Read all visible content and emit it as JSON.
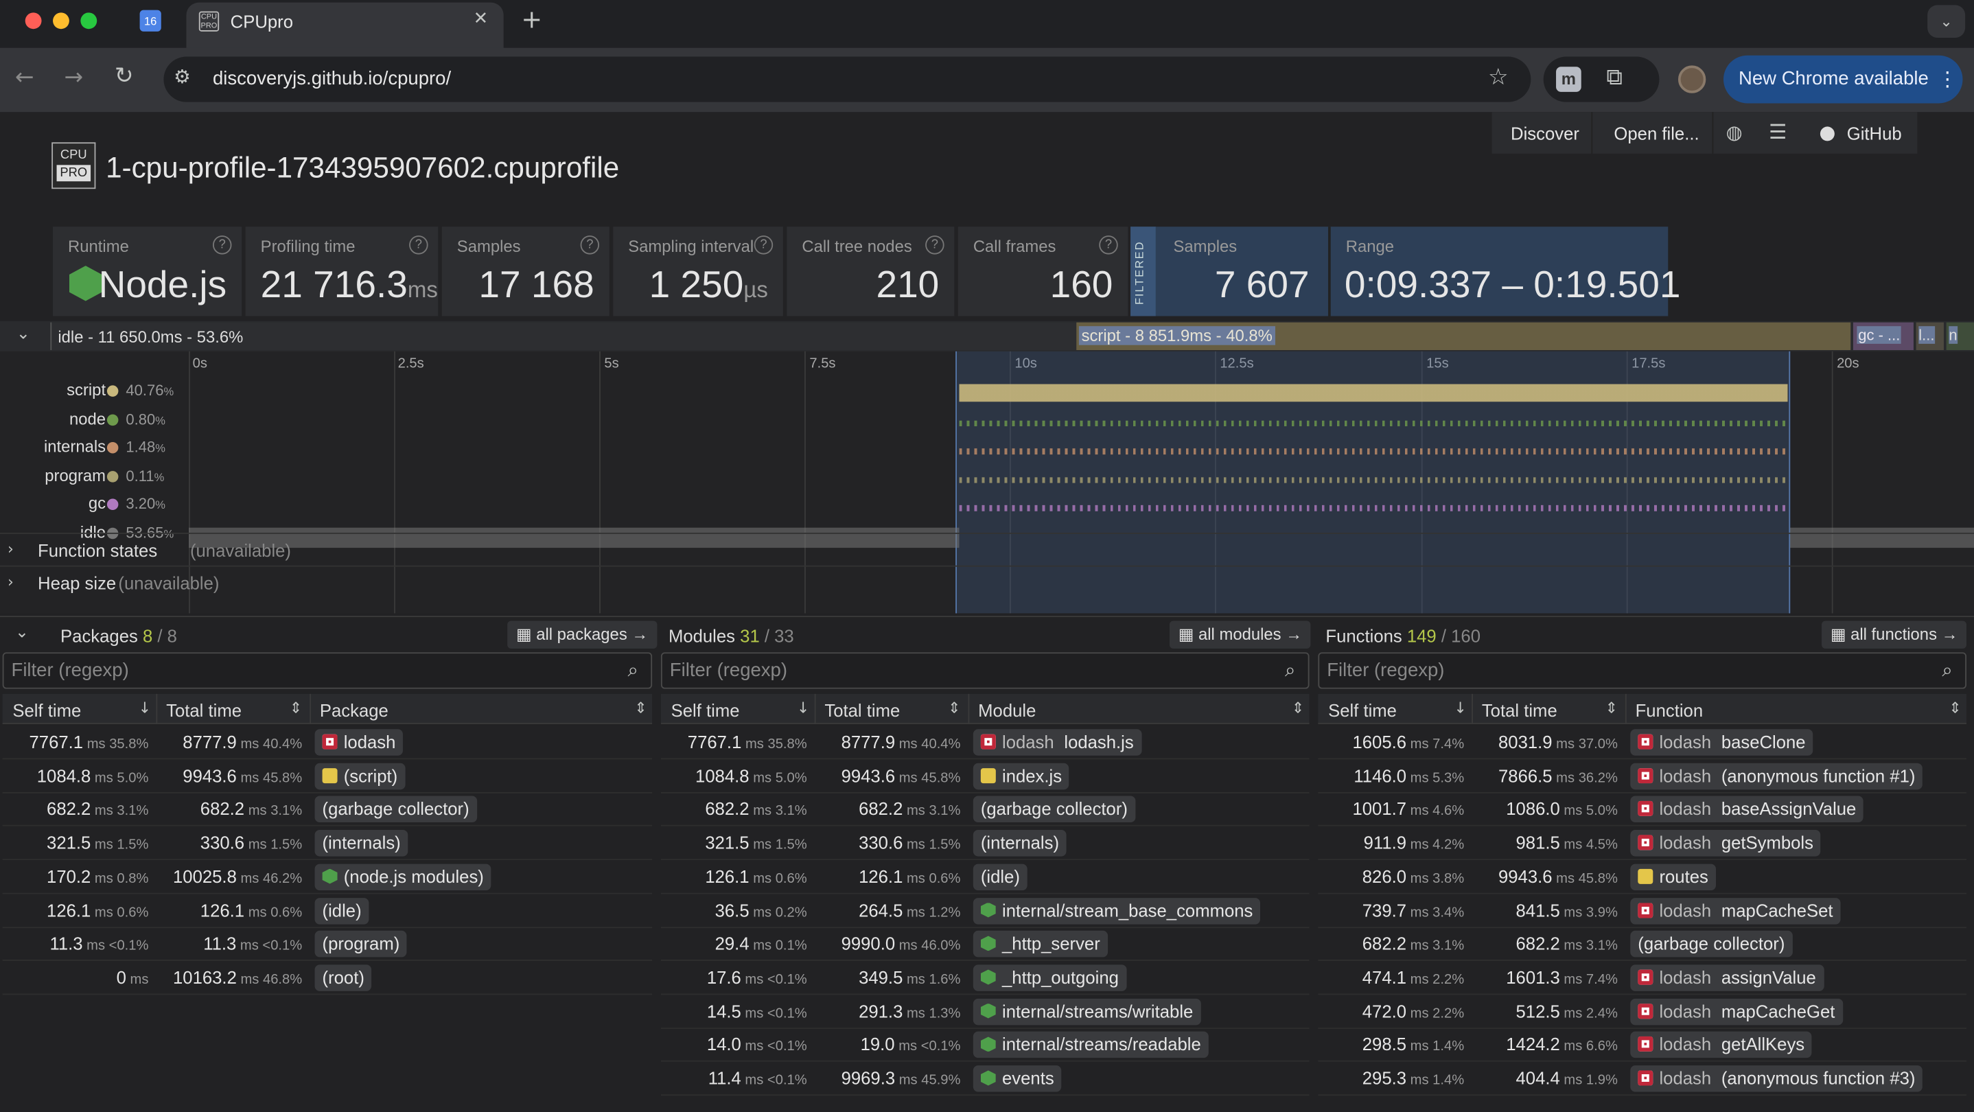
{
  "browser": {
    "tab_title": "CPUpro",
    "url": "discoveryjs.github.io/cpupro/",
    "update_label": "New Chrome available",
    "calendar_day": "16"
  },
  "nav": {
    "discover": "Discover",
    "open_file": "Open file...",
    "github": "GitHub"
  },
  "logo": {
    "top": "CPU",
    "bottom": "PRO"
  },
  "profile_title": "1-cpu-profile-1734395907602.cpuprofile",
  "stats": [
    {
      "label": "Runtime",
      "value": "Node.js",
      "unit": ""
    },
    {
      "label": "Profiling time",
      "value": "21 716.3",
      "unit": "ms"
    },
    {
      "label": "Samples",
      "value": "17 168",
      "unit": ""
    },
    {
      "label": "Sampling interval",
      "value": "1 250",
      "unit": "µs"
    },
    {
      "label": "Call tree nodes",
      "value": "210",
      "unit": ""
    },
    {
      "label": "Call frames",
      "value": "160",
      "unit": ""
    }
  ],
  "filtered": {
    "tag": "FILTERED",
    "samples_label": "Samples",
    "samples_value": "7 607",
    "range_label": "Range",
    "range_value": "0:09.337 – 0:19.501"
  },
  "timeline": {
    "idle_bar": "idle - 11 650.0ms - 53.6%",
    "script_bar": "script - 8 851.9ms - 40.8%",
    "gc_bar": "gc - ...",
    "mini1": "l...",
    "mini2": "n",
    "ticks": [
      "0s",
      "2.5s",
      "5s",
      "7.5s",
      "10s",
      "12.5s",
      "15s",
      "17.5s",
      "20s"
    ],
    "tracks": [
      {
        "name": "script",
        "pct": "40.76",
        "unit": "%",
        "color": "#c9b87d"
      },
      {
        "name": "node",
        "pct": "0.80",
        "unit": "%",
        "color": "#6e9a4c"
      },
      {
        "name": "internals",
        "pct": "1.48",
        "unit": "%",
        "color": "#c48f6a"
      },
      {
        "name": "program",
        "pct": "0.11",
        "unit": "%",
        "color": "#a8a070"
      },
      {
        "name": "gc",
        "pct": "3.20",
        "unit": "%",
        "color": "#b07ac0"
      },
      {
        "name": "idle",
        "pct": "53.65",
        "unit": "%",
        "color": "#777777"
      }
    ],
    "function_states": "Function states",
    "function_states_note": "(unavailable)",
    "heap_size": "Heap size",
    "heap_size_note": "(unavailable)"
  },
  "packages": {
    "title": "Packages",
    "count": "8",
    "total": "8",
    "all_label": "all packages →",
    "filter_placeholder": "Filter (regexp)",
    "cols": [
      "Self time",
      "Total time",
      "Package"
    ],
    "rows": [
      {
        "self": "7767.1",
        "sp": "35.8%",
        "total": "8777.9",
        "tp": "40.4%",
        "icon": "lod",
        "pkg": "",
        "name": "lodash"
      },
      {
        "self": "1084.8",
        "sp": "5.0%",
        "total": "9943.6",
        "tp": "45.8%",
        "icon": "js",
        "pkg": "",
        "name": "(script)"
      },
      {
        "self": "682.2",
        "sp": "3.1%",
        "total": "682.2",
        "tp": "3.1%",
        "icon": "",
        "pkg": "",
        "name": "(garbage collector)"
      },
      {
        "self": "321.5",
        "sp": "1.5%",
        "total": "330.6",
        "tp": "1.5%",
        "icon": "",
        "pkg": "",
        "name": "(internals)"
      },
      {
        "self": "170.2",
        "sp": "0.8%",
        "total": "10025.8",
        "tp": "46.2%",
        "icon": "nd",
        "pkg": "",
        "name": "(node.js modules)"
      },
      {
        "self": "126.1",
        "sp": "0.6%",
        "total": "126.1",
        "tp": "0.6%",
        "icon": "",
        "pkg": "",
        "name": "(idle)"
      },
      {
        "self": "11.3",
        "sp": "<0.1%",
        "total": "11.3",
        "tp": "<0.1%",
        "icon": "",
        "pkg": "",
        "name": "(program)"
      },
      {
        "self": "0",
        "sp": "",
        "total": "10163.2",
        "tp": "46.8%",
        "icon": "",
        "pkg": "",
        "name": "(root)"
      }
    ]
  },
  "modules": {
    "title": "Modules",
    "count": "31",
    "total": "33",
    "all_label": "all modules →",
    "filter_placeholder": "Filter (regexp)",
    "cols": [
      "Self time",
      "Total time",
      "Module"
    ],
    "rows": [
      {
        "self": "7767.1",
        "sp": "35.8%",
        "total": "8777.9",
        "tp": "40.4%",
        "icon": "lod",
        "pkg": "lodash",
        "name": "lodash.js"
      },
      {
        "self": "1084.8",
        "sp": "5.0%",
        "total": "9943.6",
        "tp": "45.8%",
        "icon": "js",
        "pkg": "",
        "name": "index.js"
      },
      {
        "self": "682.2",
        "sp": "3.1%",
        "total": "682.2",
        "tp": "3.1%",
        "icon": "",
        "pkg": "",
        "name": "(garbage collector)"
      },
      {
        "self": "321.5",
        "sp": "1.5%",
        "total": "330.6",
        "tp": "1.5%",
        "icon": "",
        "pkg": "",
        "name": "(internals)"
      },
      {
        "self": "126.1",
        "sp": "0.6%",
        "total": "126.1",
        "tp": "0.6%",
        "icon": "",
        "pkg": "",
        "name": "(idle)"
      },
      {
        "self": "36.5",
        "sp": "0.2%",
        "total": "264.5",
        "tp": "1.2%",
        "icon": "nd",
        "pkg": "",
        "name": "internal/stream_base_commons"
      },
      {
        "self": "29.4",
        "sp": "0.1%",
        "total": "9990.0",
        "tp": "46.0%",
        "icon": "nd",
        "pkg": "",
        "name": "_http_server"
      },
      {
        "self": "17.6",
        "sp": "<0.1%",
        "total": "349.5",
        "tp": "1.6%",
        "icon": "nd",
        "pkg": "",
        "name": "_http_outgoing"
      },
      {
        "self": "14.5",
        "sp": "<0.1%",
        "total": "291.3",
        "tp": "1.3%",
        "icon": "nd",
        "pkg": "",
        "name": "internal/streams/writable"
      },
      {
        "self": "14.0",
        "sp": "<0.1%",
        "total": "19.0",
        "tp": "<0.1%",
        "icon": "nd",
        "pkg": "",
        "name": "internal/streams/readable"
      },
      {
        "self": "11.4",
        "sp": "<0.1%",
        "total": "9969.3",
        "tp": "45.9%",
        "icon": "nd",
        "pkg": "",
        "name": "events"
      }
    ]
  },
  "functions": {
    "title": "Functions",
    "count": "149",
    "total": "160",
    "all_label": "all functions →",
    "filter_placeholder": "Filter (regexp)",
    "cols": [
      "Self time",
      "Total time",
      "Function"
    ],
    "rows": [
      {
        "self": "1605.6",
        "sp": "7.4%",
        "total": "8031.9",
        "tp": "37.0%",
        "icon": "lod",
        "pkg": "lodash",
        "name": "baseClone"
      },
      {
        "self": "1146.0",
        "sp": "5.3%",
        "total": "7866.5",
        "tp": "36.2%",
        "icon": "lod",
        "pkg": "lodash",
        "name": "(anonymous function #1)"
      },
      {
        "self": "1001.7",
        "sp": "4.6%",
        "total": "1086.0",
        "tp": "5.0%",
        "icon": "lod",
        "pkg": "lodash",
        "name": "baseAssignValue"
      },
      {
        "self": "911.9",
        "sp": "4.2%",
        "total": "981.5",
        "tp": "4.5%",
        "icon": "lod",
        "pkg": "lodash",
        "name": "getSymbols"
      },
      {
        "self": "826.0",
        "sp": "3.8%",
        "total": "9943.6",
        "tp": "45.8%",
        "icon": "js",
        "pkg": "",
        "name": "routes"
      },
      {
        "self": "739.7",
        "sp": "3.4%",
        "total": "841.5",
        "tp": "3.9%",
        "icon": "lod",
        "pkg": "lodash",
        "name": "mapCacheSet"
      },
      {
        "self": "682.2",
        "sp": "3.1%",
        "total": "682.2",
        "tp": "3.1%",
        "icon": "",
        "pkg": "",
        "name": "(garbage collector)"
      },
      {
        "self": "474.1",
        "sp": "2.2%",
        "total": "1601.3",
        "tp": "7.4%",
        "icon": "lod",
        "pkg": "lodash",
        "name": "assignValue"
      },
      {
        "self": "472.0",
        "sp": "2.2%",
        "total": "512.5",
        "tp": "2.4%",
        "icon": "lod",
        "pkg": "lodash",
        "name": "mapCacheGet"
      },
      {
        "self": "298.5",
        "sp": "1.4%",
        "total": "1424.2",
        "tp": "6.6%",
        "icon": "lod",
        "pkg": "lodash",
        "name": "getAllKeys"
      },
      {
        "self": "295.3",
        "sp": "1.4%",
        "total": "404.4",
        "tp": "1.9%",
        "icon": "lod",
        "pkg": "lodash",
        "name": "(anonymous function #3)"
      }
    ]
  },
  "units": {
    "ms": "ms"
  }
}
